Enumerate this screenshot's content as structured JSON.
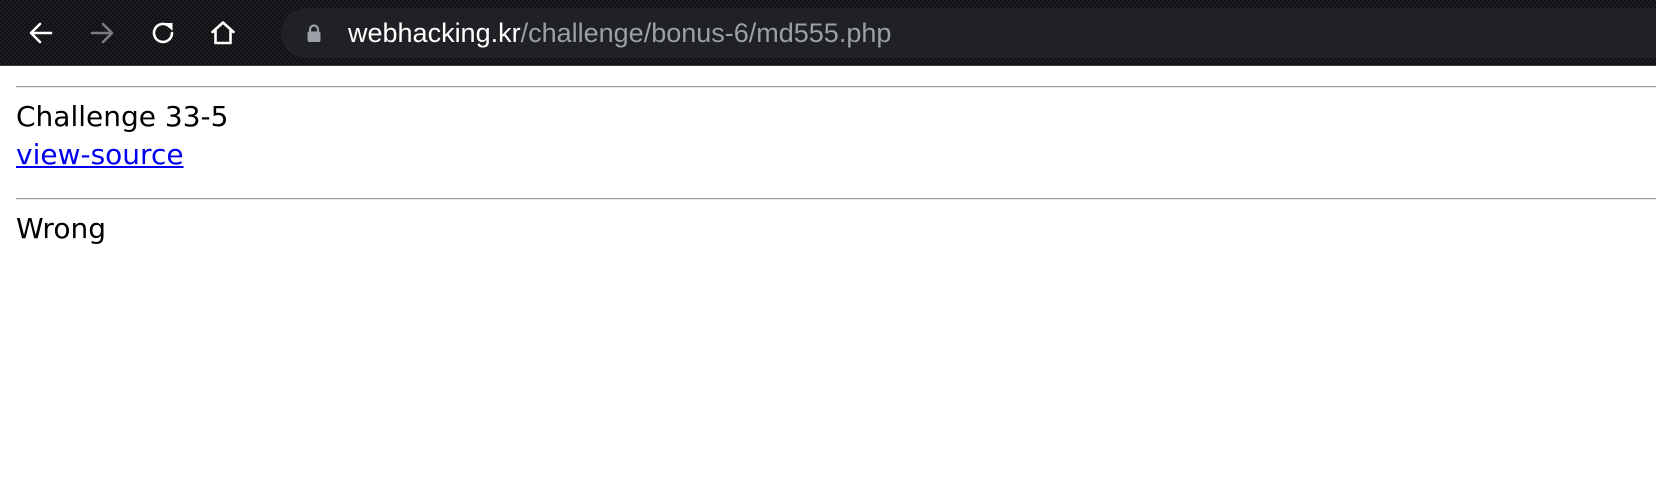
{
  "browser": {
    "nav": {
      "back_icon": "arrow-left-icon",
      "forward_icon": "arrow-right-icon",
      "reload_icon": "reload-icon",
      "home_icon": "home-icon"
    },
    "address_bar": {
      "host": "webhacking.kr",
      "path": "/challenge/bonus-6/md555.php",
      "lock_icon": "lock-icon"
    },
    "colors": {
      "toolbar": "#111214",
      "omnibox": "#202124",
      "host_text": "#ffffff",
      "path_text": "#9aa0a6"
    }
  },
  "page": {
    "title": "Challenge 33-5",
    "view_source_link": "view-source",
    "result": "Wrong",
    "colors": {
      "link": "#0000ee",
      "text": "#000000"
    }
  }
}
